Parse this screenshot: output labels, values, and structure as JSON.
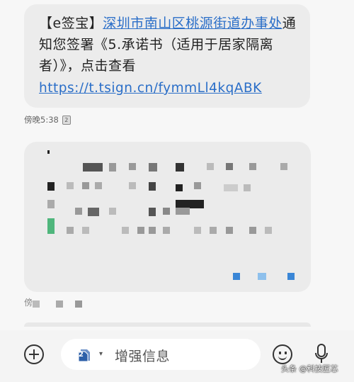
{
  "message": {
    "p1": "【e签宝】",
    "link1": "深圳市南山区桃源街道办事处",
    "p2": "通知您签署《5.承诺书（适用于居家隔离者）》，点击查看",
    "url": "https://t.tsign.cn/fymmLl4kqABK"
  },
  "meta": {
    "time": "傍晚5:38",
    "sim": "2"
  },
  "blurred_meta": {
    "char": "傍"
  },
  "input_bar": {
    "sim_label": "2",
    "placeholder": "增强信息"
  },
  "watermark": "头条 @科技匠芯",
  "colors": {
    "link": "#2a6ec8",
    "bubble": "#ececec",
    "background": "#f7f7f7"
  },
  "icons": [
    "plus-icon",
    "sim-card-icon",
    "emoji-icon",
    "microphone-icon"
  ]
}
